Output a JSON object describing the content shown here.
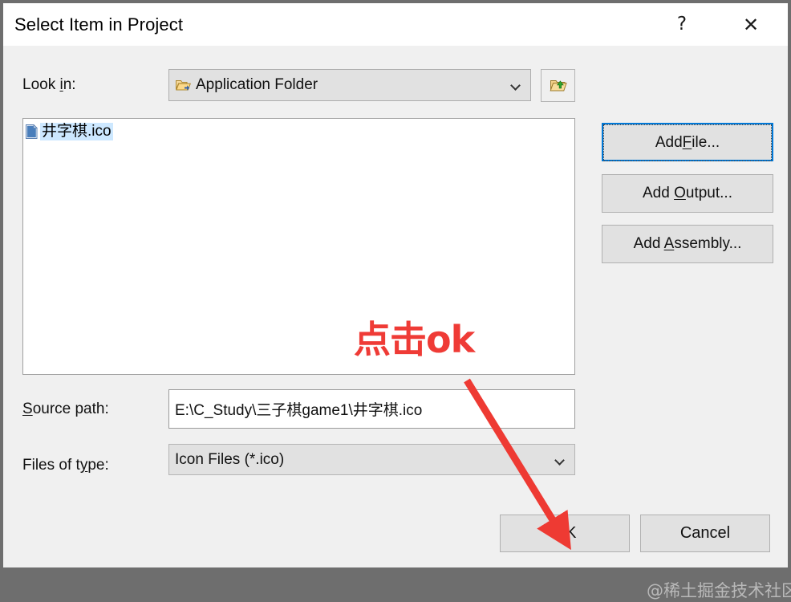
{
  "window": {
    "title": "Select Item in Project",
    "help_glyph": "?",
    "close_glyph": "✕"
  },
  "lookin": {
    "label_pre": "Look ",
    "label_accel": "i",
    "label_post": "n:",
    "value": "Application Folder",
    "browse_up_title": "Up One Level"
  },
  "file_list": {
    "items": [
      {
        "name": "井字棋.ico",
        "selected": true
      }
    ]
  },
  "side_buttons": [
    {
      "pre": "Add ",
      "accel": "F",
      "post": "ile...",
      "focused": true
    },
    {
      "pre": "Add ",
      "accel": "O",
      "post": "utput...",
      "focused": false
    },
    {
      "pre": "Add ",
      "accel": "A",
      "post": "ssembly...",
      "focused": false
    }
  ],
  "source_path": {
    "label_pre": "",
    "label_accel": "S",
    "label_post": "ource path:",
    "value": "E:\\C_Study\\三子棋game1\\井字棋.ico",
    "placeholder": ""
  },
  "files_of_type": {
    "label_pre": "Files of t",
    "label_accel": "y",
    "label_post": "pe:",
    "value": "Icon Files (*.ico)"
  },
  "bottom_buttons": {
    "ok_label": "OK",
    "cancel_label": "Cancel"
  },
  "annotations": {
    "red_text": "点击ok",
    "red_color": "#ef3b36",
    "watermark": "@稀土掘金技术社区"
  },
  "colors": {
    "accent": "#0078d7",
    "window_bg": "#f0f0f0",
    "frame": "#6e6e6e",
    "selection": "#cde8ff"
  }
}
